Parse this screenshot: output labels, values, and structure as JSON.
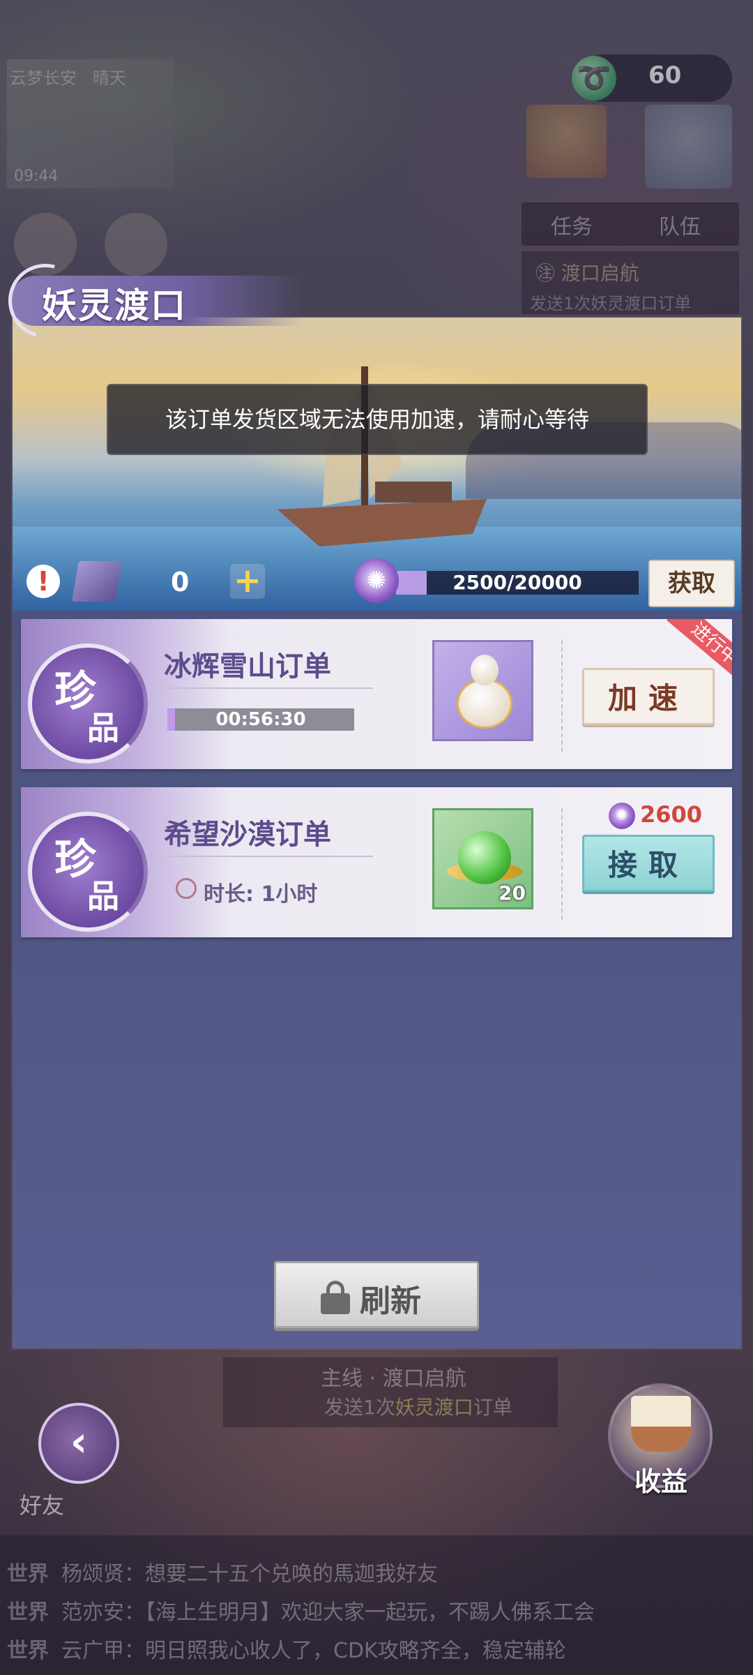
{
  "hud": {
    "minimap_location": "云梦长安",
    "minimap_weather": "晴天",
    "minimap_time": "09:44",
    "currency_value": "60",
    "tabs": [
      "任务",
      "队伍"
    ],
    "quest_title": "渡口启航",
    "quest_desc": "发送1次妖灵渡口订单"
  },
  "panel": {
    "title": "妖灵渡口",
    "toast": "该订单发货区域无法使用加速，请耐心等待",
    "ticket_count": "0",
    "plus_label": "+",
    "spirit_progress_text": "2500/20000",
    "spirit_progress_fraction": 0.125,
    "get_button": "获取"
  },
  "orders": [
    {
      "rarity_a": "珍",
      "rarity_b": "品",
      "name": "冰辉雪山订单",
      "timer": "00:56:30",
      "timer_fraction": 0.04,
      "status_tag": "进行中",
      "action": "加速",
      "reward_icon": "gourd-icon"
    },
    {
      "rarity_a": "珍",
      "rarity_b": "品",
      "name": "希望沙漠订单",
      "duration": "时长: 1小时",
      "cost": "2600",
      "reward_qty": "20",
      "action": "接取",
      "reward_icon": "jade-orb-icon"
    }
  ],
  "refresh_label": "刷新",
  "bottom": {
    "mainline_title": "主线 · 渡口启航",
    "mainline_pre": "发送1次",
    "mainline_hl": "妖灵渡口",
    "mainline_post": "订单",
    "friend_label": "好友",
    "income_label": "收益"
  },
  "chat": [
    {
      "channel": "世界",
      "text": "杨颂贤：想要二十五个兑唤的馬迦我好友"
    },
    {
      "channel": "世界",
      "text": "范亦安：【海上生明月】欢迎大家一起玩，不踢人佛系工会"
    },
    {
      "channel": "世界",
      "text": "云广甲：明日照我心收人了，CDK攻略齐全，稳定辅轮"
    }
  ],
  "colors": {
    "panel": "#4d5581",
    "rarity": "#6d4aa2",
    "accent_red": "#d0473a",
    "accept_button": "#8fd3d6"
  }
}
